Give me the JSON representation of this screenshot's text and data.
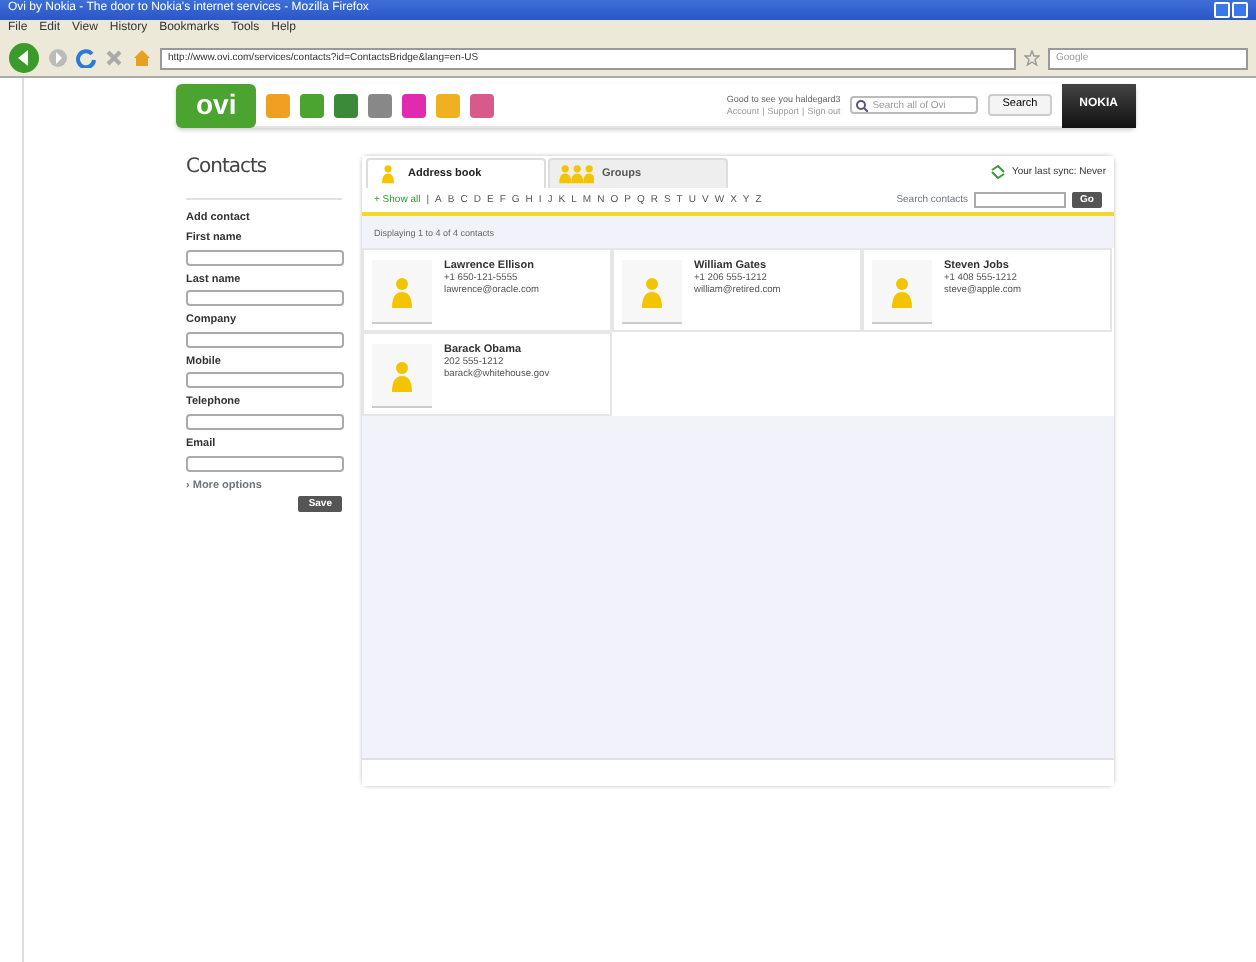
{
  "window": {
    "title": "Ovi by Nokia - The door to Nokia's internet services - Mozilla Firefox"
  },
  "menu": [
    "File",
    "Edit",
    "View",
    "History",
    "Bookmarks",
    "Tools",
    "Help"
  ],
  "address_bar": {
    "url": "http://www.ovi.com/services/contacts?id=ContactsBridge&lang=en-US"
  },
  "web_search": {
    "placeholder": "Google"
  },
  "site_header": {
    "logo": "ovi",
    "greeting": "Good to see you haldegard3",
    "links": [
      "Account",
      "Support",
      "Sign out"
    ],
    "link_separator": "|",
    "search_placeholder": "Search all of Ovi",
    "search_button": "Search",
    "brand": "NOKIA"
  },
  "page_title": "Contacts",
  "add_contact": {
    "heading": "Add contact",
    "fields": [
      "First name",
      "Last name",
      "Company",
      "Mobile",
      "Telephone",
      "Email"
    ],
    "more_options": "› More options",
    "save": "Save"
  },
  "tabs": [
    {
      "label": "Address book",
      "selected": true
    },
    {
      "label": "Groups",
      "selected": false
    }
  ],
  "sync_status": "Your last sync: Never",
  "filter": {
    "show_all": "+ Show all",
    "separator": "|",
    "letters": [
      "A",
      "B",
      "C",
      "D",
      "E",
      "F",
      "G",
      "H",
      "I",
      "J",
      "K",
      "L",
      "M",
      "N",
      "O",
      "P",
      "Q",
      "R",
      "S",
      "T",
      "U",
      "V",
      "W",
      "X",
      "Y",
      "Z"
    ],
    "search_label": "Search contacts",
    "go": "Go"
  },
  "count": "Displaying 1 to 4 of 4 contacts",
  "contacts": [
    {
      "name": "Lawrence Ellison",
      "phone": "+1 650-121-5555",
      "email": "lawrence@oracle.com"
    },
    {
      "name": "William Gates",
      "phone": "+1 206 555-1212",
      "email": "william@retired.com"
    },
    {
      "name": "Steven Jobs",
      "phone": "+1 408 555-1212",
      "email": "steve@apple.com"
    },
    {
      "name": "Barack Obama",
      "phone": "202 555-1212",
      "email": "barack@whitehouse.gov"
    }
  ]
}
